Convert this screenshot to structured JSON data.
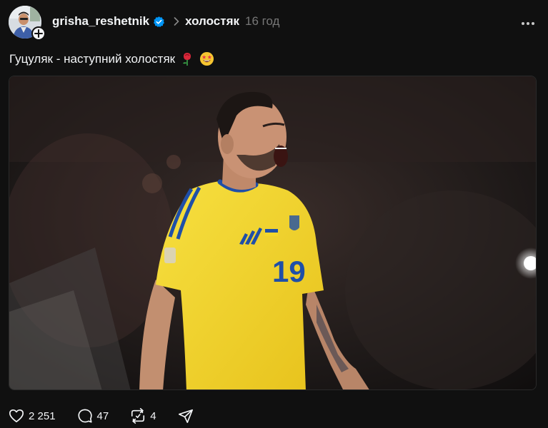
{
  "author": {
    "username": "grisha_reshetnik",
    "verified": true,
    "avatar_icon": "profile-photo",
    "follow_icon": "plus-icon"
  },
  "topic": "холостяк",
  "time": "16 год",
  "caption": {
    "text": "Гуцуляк - наступний холостяк",
    "emojis": [
      "rose",
      "star-struck-face"
    ]
  },
  "photo": {
    "description_icon": "football-player-photo",
    "jersey_number": "19"
  },
  "actions": {
    "likes": "2 251",
    "replies": "47",
    "reposts": "4"
  },
  "colors": {
    "background": "#101010",
    "text": "#f3f5f7",
    "muted": "#777777",
    "verified": "#0095f6",
    "jersey_yellow": "#f4d82a",
    "jersey_blue": "#1f4fa8"
  }
}
